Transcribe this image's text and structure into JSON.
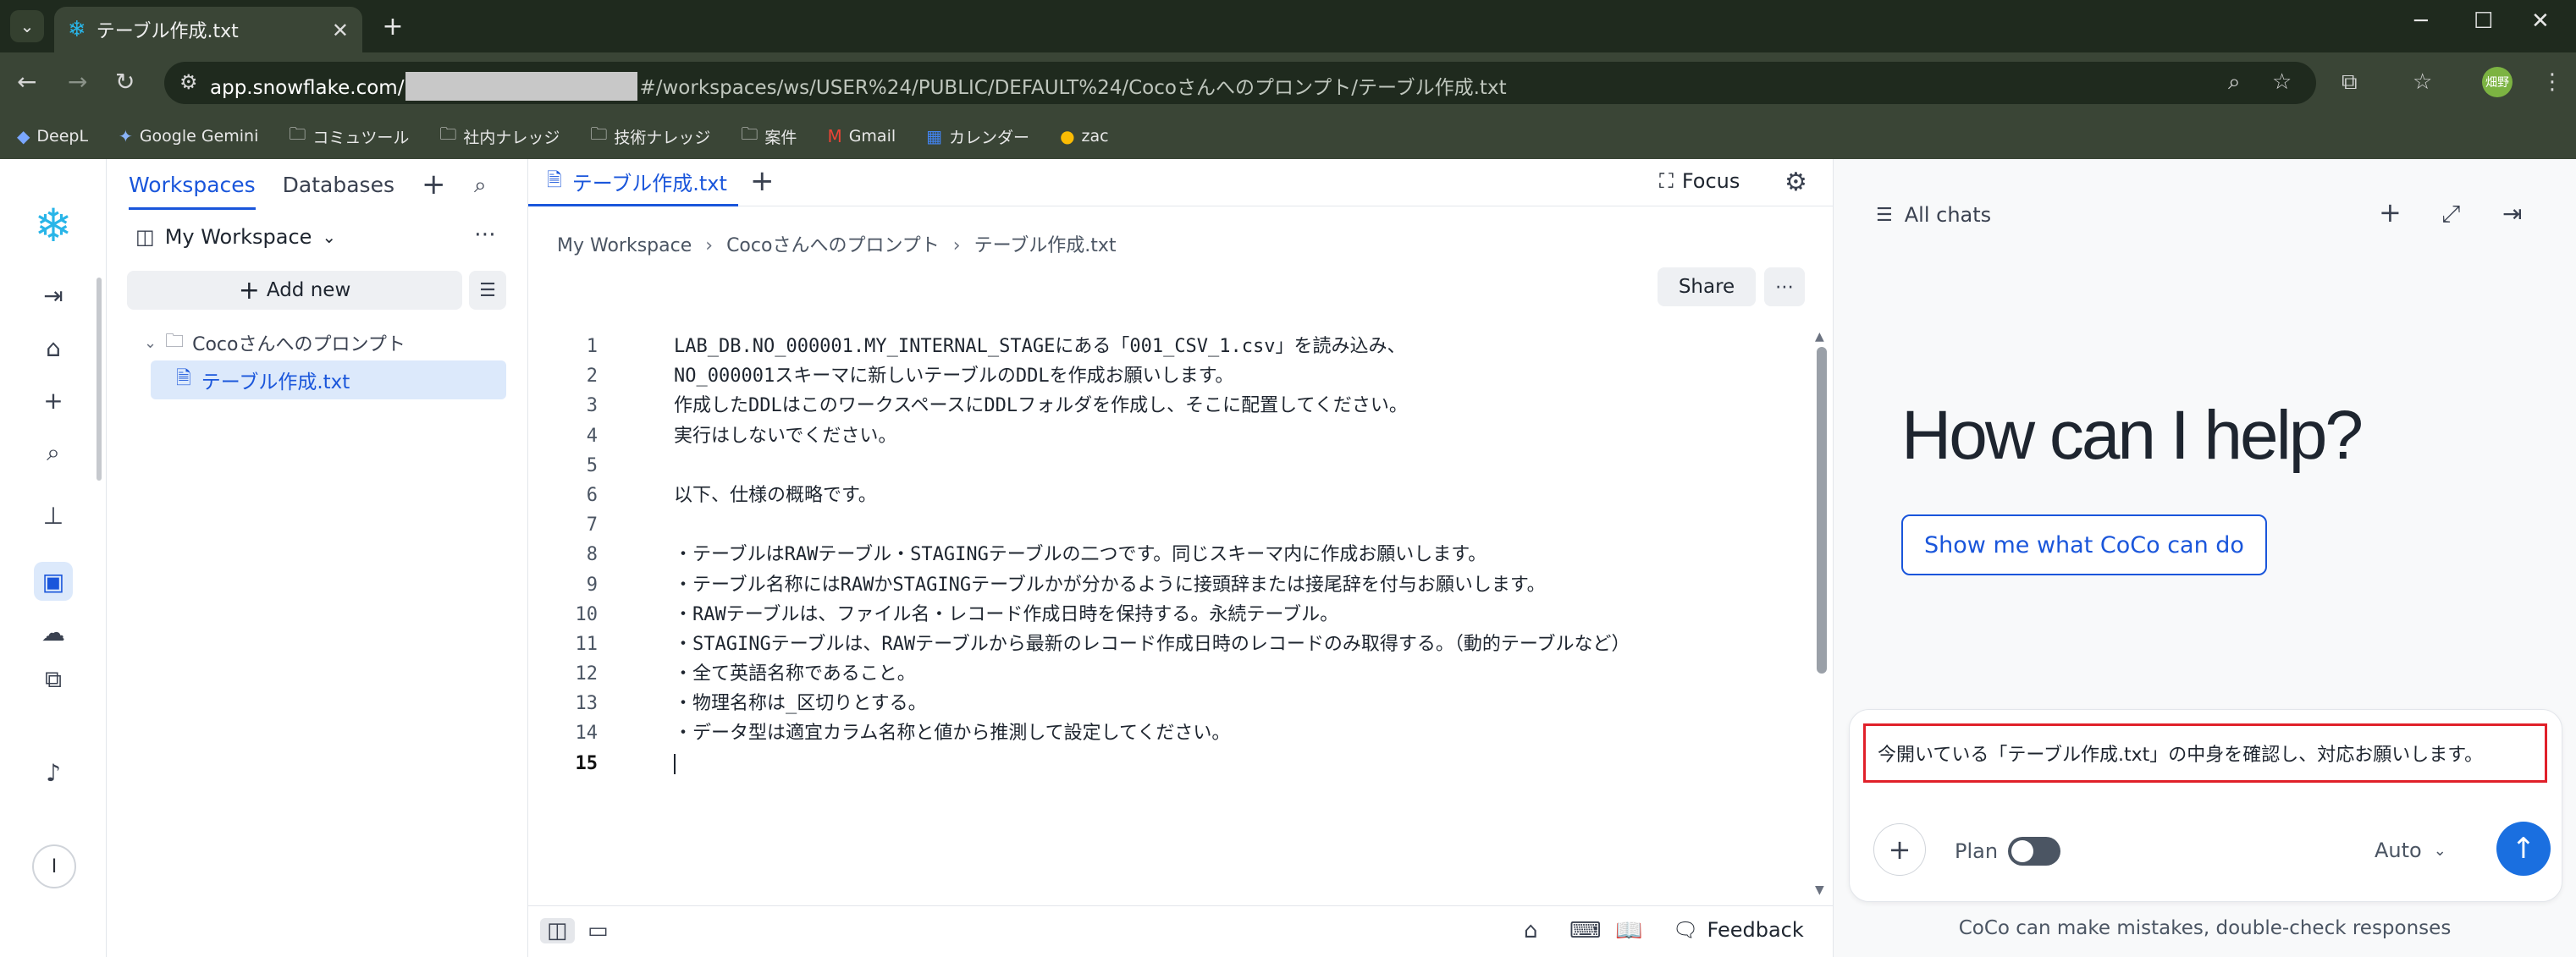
{
  "browser": {
    "tab_title": "テーブル作成.txt",
    "url_host": "app.snowflake.com/",
    "url_path": "#/workspaces/ws/USER%24/PUBLIC/DEFAULT%24/Cocoさんへのプロンプト/テーブル作成.txt",
    "profile_label": "畑野",
    "bookmarks": [
      "DeepL",
      "Google Gemini",
      "コミュツール",
      "社内ナレッジ",
      "技術ナレッジ",
      "案件",
      "Gmail",
      "カレンダー",
      "zac"
    ]
  },
  "explorer": {
    "tabs": [
      "Workspaces",
      "Databases"
    ],
    "workspace_name": "My Workspace",
    "add_new_label": "Add new",
    "folder_name": "Cocoさんへのプロンプト",
    "file_name": "テーブル作成.txt"
  },
  "editor": {
    "tab_label": "テーブル作成.txt",
    "focus_label": "Focus",
    "breadcrumbs": [
      "My Workspace",
      "Cocoさんへのプロンプト",
      "テーブル作成.txt"
    ],
    "share_label": "Share",
    "feedback_label": "Feedback",
    "current_line": 15,
    "lines": [
      "LAB_DB.NO_000001.MY_INTERNAL_STAGEにある「001_CSV_1.csv」を読み込み、",
      "NO_000001スキーマに新しいテーブルのDDLを作成お願いします。",
      "作成したDDLはこのワークスペースにDDLフォルダを作成し、そこに配置してください。",
      "実行はしないでください。",
      "",
      "以下、仕様の概略です。",
      "",
      "・テーブルはRAWテーブル・STAGINGテーブルの二つです。同じスキーマ内に作成お願いします。",
      "・テーブル名称にはRAWかSTAGINGテーブルかが分かるように接頭辞または接尾辞を付与お願いします。",
      "・RAWテーブルは、ファイル名・レコード作成日時を保持する。永続テーブル。",
      "・STAGINGテーブルは、RAWテーブルから最新のレコード作成日時のレコードのみ取得する。（動的テーブルなど）",
      "・全て英語名称であること。",
      "・物理名称は_区切りとする。",
      "・データ型は適宜カラム名称と値から推測して設定してください。",
      ""
    ]
  },
  "chat": {
    "all_chats_label": "All chats",
    "heading": "How can I help?",
    "show_button": "Show me what CoCo can do",
    "prompt_text": "今開いている「テーブル作成.txt」の中身を確認し、対応お願いします。",
    "plan_label": "Plan",
    "model_label": "Auto",
    "disclaimer": "CoCo can make mistakes, double-check responses"
  },
  "colors": {
    "accent": "#1a56db",
    "snowflake_brand": "#29b5e8",
    "highlight_border": "#e0202a",
    "chrome_dark": "#1f2a1e",
    "chrome_mid": "#3a4536"
  }
}
